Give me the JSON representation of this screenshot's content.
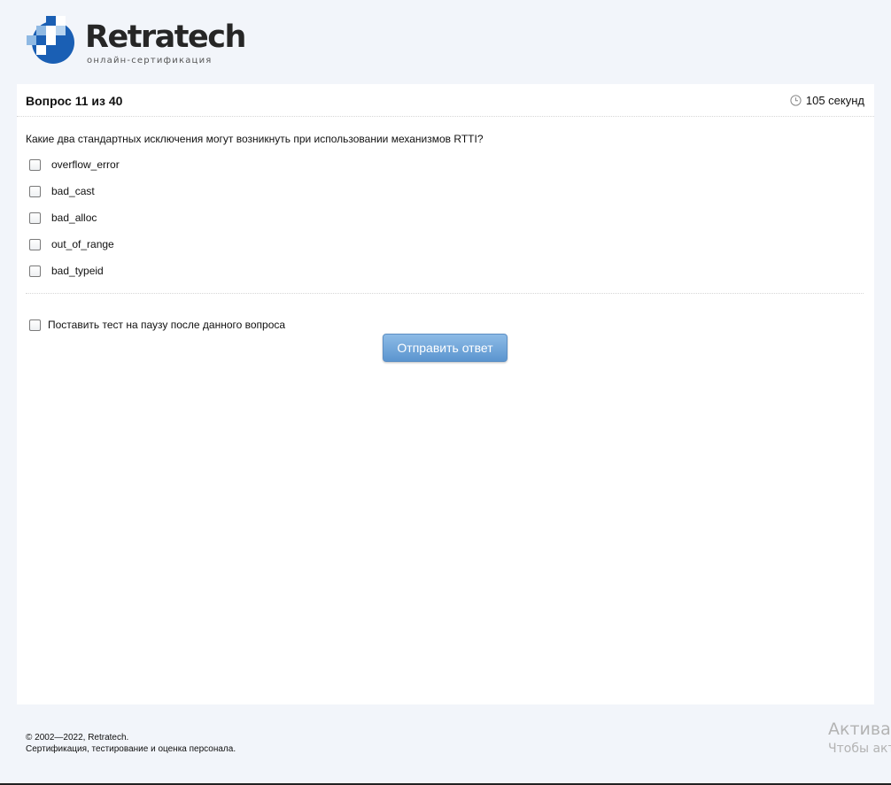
{
  "brand": {
    "name": "Retratech",
    "tagline": "онлайн-сертификация",
    "colors": {
      "dark_blue": "#1a5fb4",
      "light_blue": "#8fb9e3"
    }
  },
  "question": {
    "title": "Вопрос 11 из 40",
    "timer_icon": "clock-icon",
    "timer": "105 секунд",
    "text": "Какие два стандартных исключения могут возникнуть при использовании механизмов RTTI?",
    "options": [
      {
        "label": "overflow_error",
        "checked": false
      },
      {
        "label": "bad_cast",
        "checked": false
      },
      {
        "label": "bad_alloc",
        "checked": false
      },
      {
        "label": "out_of_range",
        "checked": false
      },
      {
        "label": "bad_typeid",
        "checked": false
      }
    ],
    "pause_label": "Поставить тест на паузу после данного вопроса",
    "submit_label": "Отправить ответ"
  },
  "footer": {
    "copyright": "© 2002—2022, Retratech.",
    "description": "Сертификация, тестирование и оценка персонала."
  },
  "watermark": {
    "line1": "Активац",
    "line2": "Чтобы акт"
  }
}
